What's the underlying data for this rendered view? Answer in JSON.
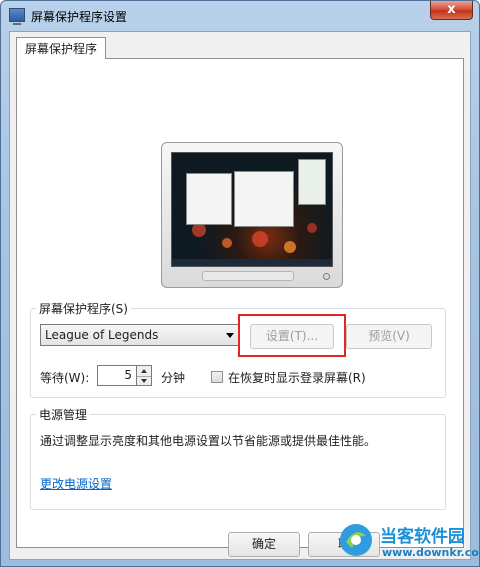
{
  "window": {
    "title": "屏幕保护程序设置",
    "close_label": "x"
  },
  "tabs": [
    {
      "label": "屏幕保护程序"
    }
  ],
  "screensaver": {
    "group_label": "屏幕保护程序(S)",
    "selected": "League of Legends",
    "settings_label": "设置(T)...",
    "preview_label": "预览(V)",
    "wait_label": "等待(W):",
    "wait_value": "5",
    "wait_unit": "分钟",
    "resume_label": "在恢复时显示登录屏幕(R)",
    "resume_checked": false
  },
  "power": {
    "group_label": "电源管理",
    "description": "通过调整显示亮度和其他电源设置以节省能源或提供最佳性能。",
    "link": "更改电源设置"
  },
  "buttons": {
    "ok": "确定",
    "cancel": "取"
  },
  "watermark": {
    "title": "当客软件园",
    "url": "www.downkr.com"
  },
  "colors": {
    "highlight": "#e02626",
    "link": "#0066cc",
    "accent": "#1d8fd6"
  }
}
